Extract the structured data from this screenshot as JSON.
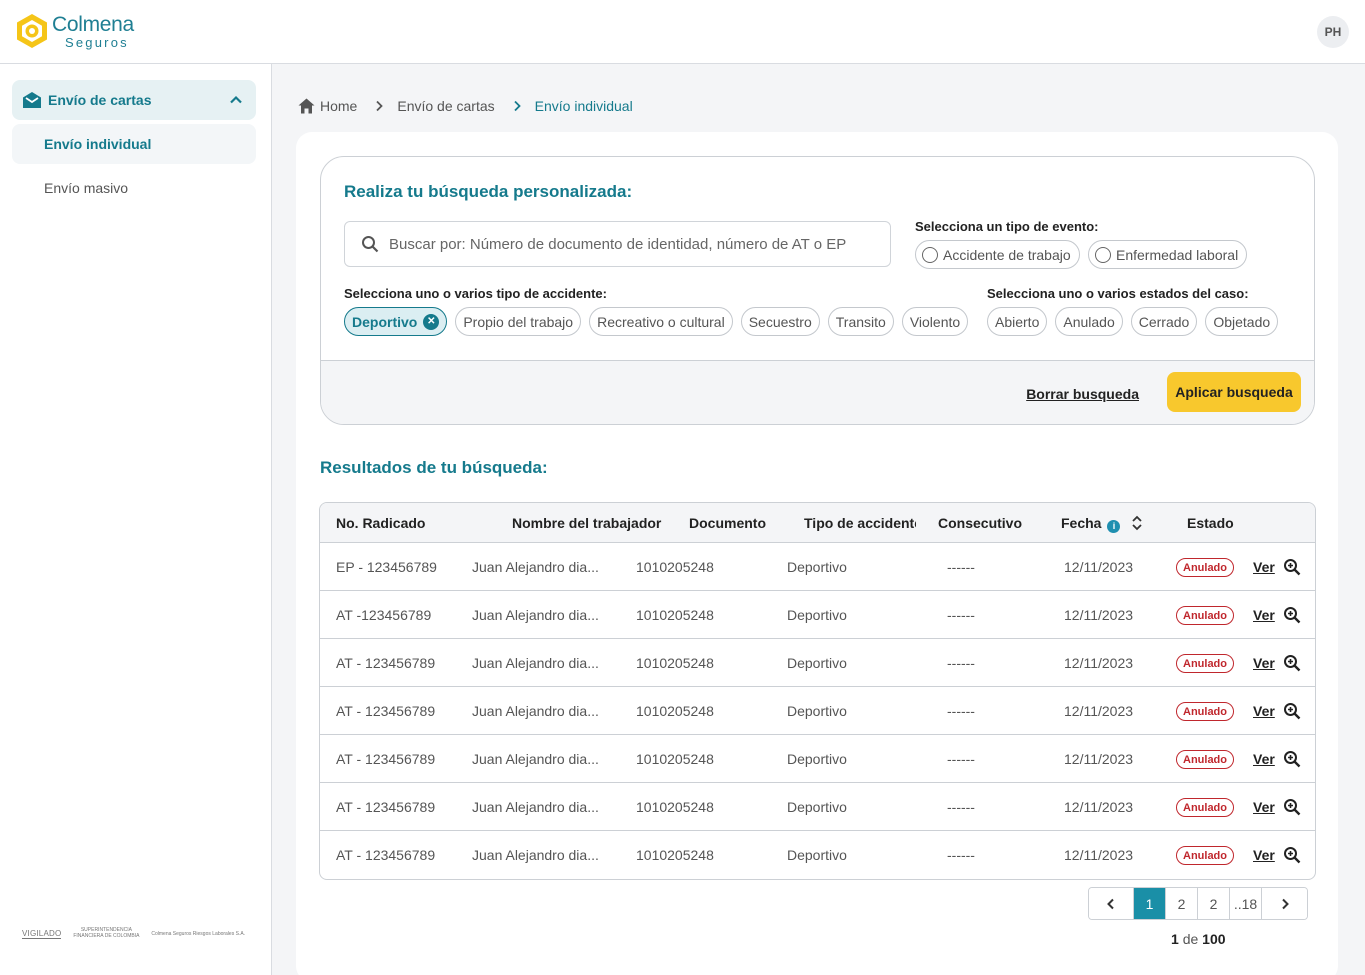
{
  "brand": {
    "name": "Colmena",
    "sub": "Seguros",
    "accent": "#157a8c",
    "primary_button": "#f8c82d",
    "danger": "#c0272d"
  },
  "user": {
    "initials": "PH"
  },
  "sidebar": {
    "group_label": "Envío de cartas",
    "items": [
      {
        "label": "Envío individual",
        "active": true
      },
      {
        "label": "Envío masivo",
        "active": false
      }
    ],
    "footer": {
      "vigilado": "VIGILADO",
      "superintendencia": "SUPERINTENDENCIA FINANCIERA DE COLOMBIA",
      "company": "Colmena Seguros Riesgos Laborales S.A."
    }
  },
  "breadcrumb": {
    "home": "Home",
    "level1": "Envío de cartas",
    "current": "Envío individual"
  },
  "search": {
    "title": "Realiza tu búsqueda personalizada:",
    "placeholder": "Buscar por: Número de documento de identidad, número de AT o EP",
    "event_type_label": "Selecciona un tipo de evento:",
    "event_types": [
      "Accidente de trabajo",
      "Enfermedad laboral"
    ],
    "accident_type_label": "Selecciona uno o varios tipo de accidente:",
    "accident_types": [
      "Deportivo",
      "Propio del trabajo",
      "Recreativo o cultural",
      "Secuestro",
      "Transito",
      "Violento"
    ],
    "selected_accident_type": "Deportivo",
    "case_state_label": "Selecciona uno o varios estados del caso:",
    "case_states": [
      "Abierto",
      "Anulado",
      "Cerrado",
      "Objetado"
    ],
    "clear_label": "Borrar busqueda",
    "apply_label": "Aplicar busqueda"
  },
  "results": {
    "title": "Resultados de tu búsqueda:",
    "columns": [
      "No. Radicado",
      "Nombre del trabajador",
      "Documento",
      "Tipo de accidente",
      "Consecutivo",
      "Fecha",
      "Estado"
    ],
    "view_label": "Ver",
    "rows": [
      {
        "radicado": "EP - 123456789",
        "nombre": "Juan Alejandro dia...",
        "documento": "1010205248",
        "tipo": "Deportivo",
        "consecutivo": "------",
        "fecha": "12/11/2023",
        "estado": "Anulado"
      },
      {
        "radicado": "AT -123456789",
        "nombre": "Juan Alejandro dia...",
        "documento": "1010205248",
        "tipo": "Deportivo",
        "consecutivo": "------",
        "fecha": "12/11/2023",
        "estado": "Anulado"
      },
      {
        "radicado": "AT - 123456789",
        "nombre": "Juan Alejandro dia...",
        "documento": "1010205248",
        "tipo": "Deportivo",
        "consecutivo": "------",
        "fecha": "12/11/2023",
        "estado": "Anulado"
      },
      {
        "radicado": "AT - 123456789",
        "nombre": "Juan Alejandro dia...",
        "documento": "1010205248",
        "tipo": "Deportivo",
        "consecutivo": "------",
        "fecha": "12/11/2023",
        "estado": "Anulado"
      },
      {
        "radicado": "AT - 123456789",
        "nombre": "Juan Alejandro dia...",
        "documento": "1010205248",
        "tipo": "Deportivo",
        "consecutivo": "------",
        "fecha": "12/11/2023",
        "estado": "Anulado"
      },
      {
        "radicado": "AT - 123456789",
        "nombre": "Juan Alejandro dia...",
        "documento": "1010205248",
        "tipo": "Deportivo",
        "consecutivo": "------",
        "fecha": "12/11/2023",
        "estado": "Anulado"
      },
      {
        "radicado": "AT - 123456789",
        "nombre": "Juan Alejandro dia...",
        "documento": "1010205248",
        "tipo": "Deportivo",
        "consecutivo": "------",
        "fecha": "12/11/2023",
        "estado": "Anulado"
      }
    ]
  },
  "pagination": {
    "pages": [
      "1",
      "2",
      "2",
      "..18"
    ],
    "current": "1",
    "of_word": "de",
    "total": "100"
  }
}
